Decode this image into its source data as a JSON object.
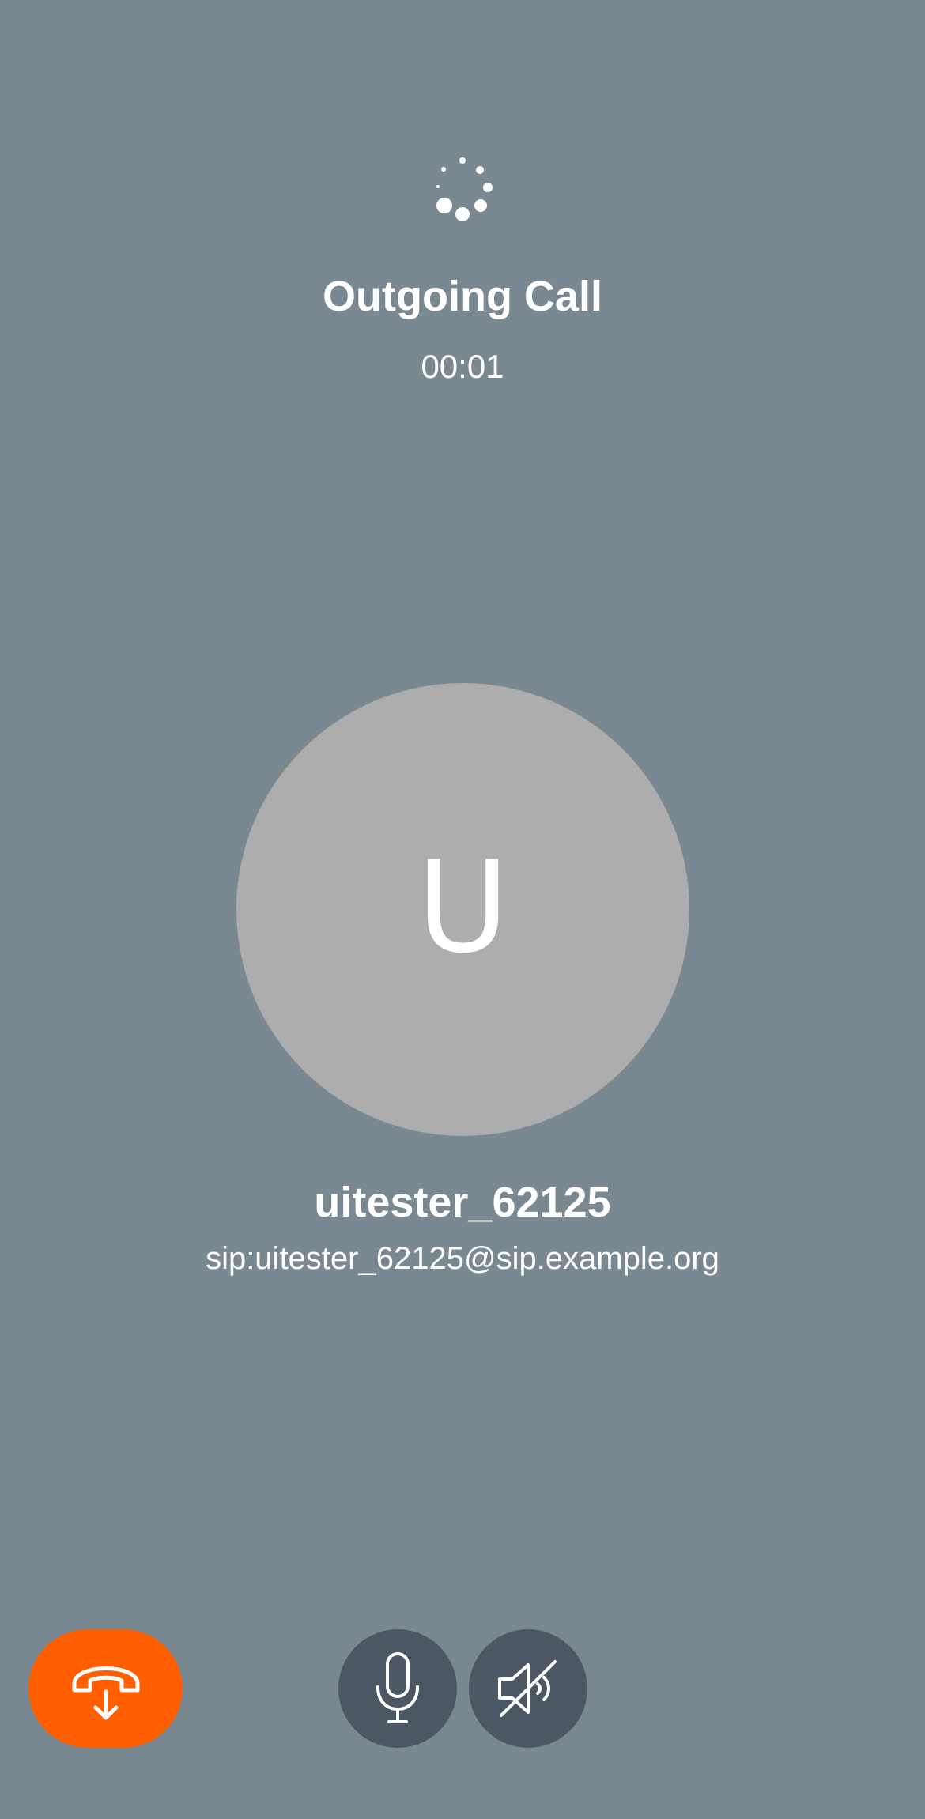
{
  "call": {
    "status_title": "Outgoing Call",
    "timer": "00:01"
  },
  "contact": {
    "initial": "U",
    "name": "uitester_62125",
    "address": "sip:uitester_62125@sip.example.org"
  },
  "icons": {
    "spinner": "loading-spinner-icon",
    "hangup": "hang-up-phone-icon",
    "microphone": "microphone-icon",
    "speaker": "speaker-muted-icon"
  },
  "colors": {
    "background": "#7a8891",
    "avatar": "#adadad",
    "hangup_button": "#ff5f00",
    "control_button": "#4b5864",
    "text": "#ffffff"
  }
}
